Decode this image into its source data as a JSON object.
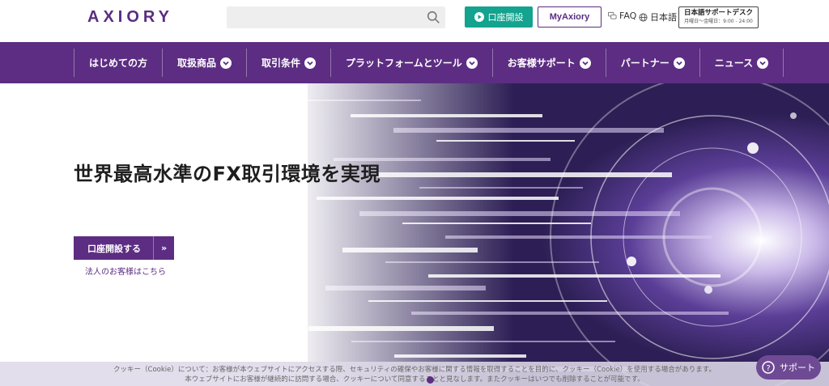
{
  "header": {
    "logo": "AXIORY",
    "search_placeholder": "",
    "open_account_label": "口座開設",
    "myaxiory_label": "MyAxiory",
    "faq_label": "FAQ",
    "language_label": "日本語",
    "support_desk": {
      "title": "日本語サポートデスク",
      "hours": "月曜日～金曜日：9:00 - 24:00"
    }
  },
  "nav": {
    "items": [
      {
        "label": "はじめての方",
        "dropdown": false
      },
      {
        "label": "取扱商品",
        "dropdown": true
      },
      {
        "label": "取引条件",
        "dropdown": true
      },
      {
        "label": "プラットフォームとツール",
        "dropdown": true
      },
      {
        "label": "お客様サポート",
        "dropdown": true
      },
      {
        "label": "パートナー",
        "dropdown": true
      },
      {
        "label": "ニュース",
        "dropdown": true
      }
    ]
  },
  "hero": {
    "headline": "世界最高水準のFX取引環境を実現",
    "cta_label": "口座開設する",
    "cta_arrow": "»",
    "corporate_link": "法人のお客様はこちら"
  },
  "cookie": {
    "line1": "クッキー（Cookie）について：お客様が本ウェブサイトにアクセスする際、セキュリティの確保やお客様に関する情報を取得することを目的に、クッキー（Cookie）を使用する場合があります。",
    "line2": "本ウェブサイトにお客様が継続的に訪問する場合、クッキーについて同意することと見なします。またクッキーはいつでも削除することが可能です。"
  },
  "support_button": {
    "label": "サポート"
  },
  "colors": {
    "brand_purple": "#5c2d82",
    "accent_green": "#13a38e"
  },
  "icons": [
    "search-icon",
    "play-icon",
    "faq-icon",
    "globe-icon",
    "chevron-down-icon",
    "question-icon"
  ]
}
